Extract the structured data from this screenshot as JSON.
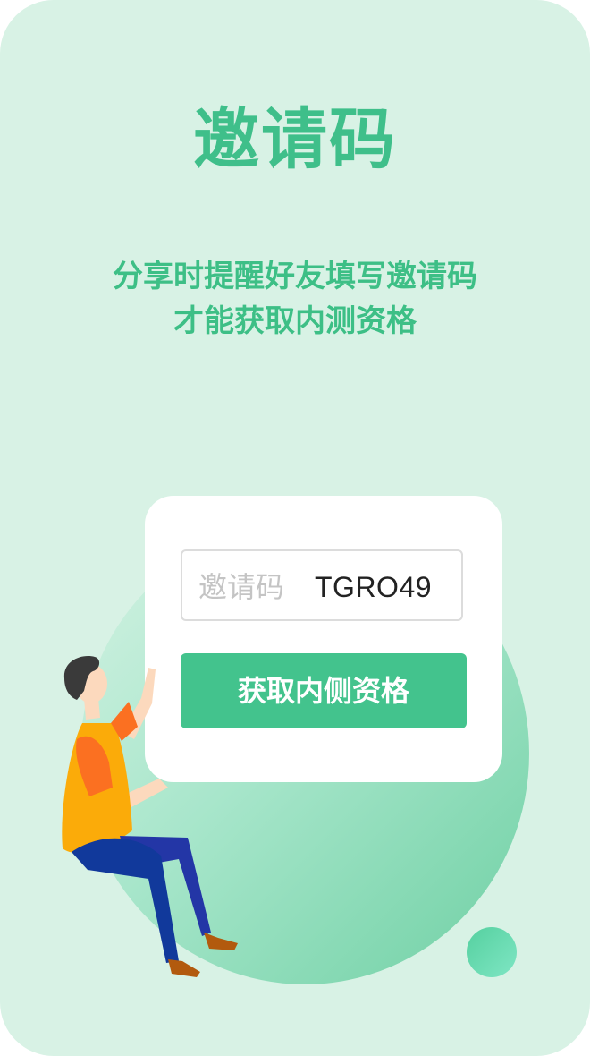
{
  "page": {
    "title": "邀请码",
    "subtitle_line1": "分享时提醒好友填写邀请码",
    "subtitle_line2": "才能获取内测资格"
  },
  "invite_form": {
    "label": "邀请码",
    "value": "TGRO49",
    "button_label": "获取内侧资格"
  },
  "colors": {
    "background": "#d8f2e5",
    "accent": "#43c38d",
    "title": "#3fbf8a"
  },
  "icons": {
    "illustration": "person-pointing-illustration",
    "decor_circle": "decor-circle"
  }
}
